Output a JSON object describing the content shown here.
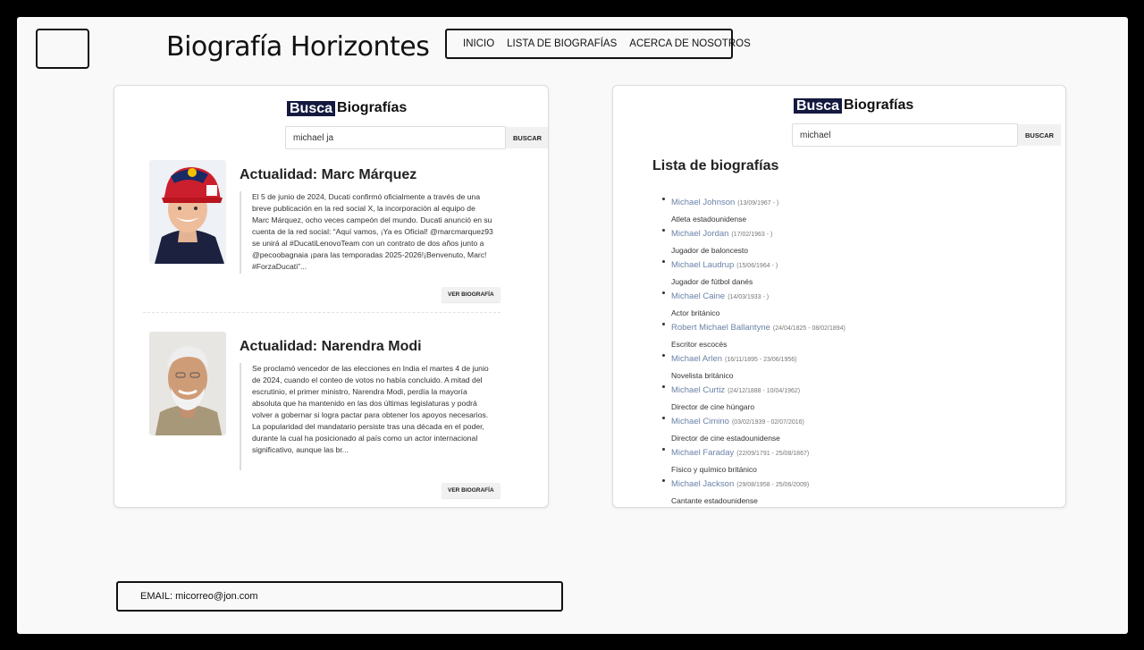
{
  "site": {
    "title": "Biografía Horizontes"
  },
  "nav": {
    "items": [
      "INICIO",
      "LISTA DE BIOGRAFÍAS",
      "ACERCA DE NOSOTROS"
    ]
  },
  "brand": {
    "part1": "Busca",
    "part2": "Biografías"
  },
  "left_panel": {
    "search": {
      "value": "michael ja",
      "button": "BUSCAR"
    },
    "cards": [
      {
        "title": "Actualidad: Marc Márquez",
        "text": "El 5 de junio de 2024, Ducati confirmó oficialmente a través de una breve publicación en la red social X, la incorporación al equipo de Marc Márquez, ocho veces campeón del mundo. Ducati anunció en su cuenta de la red social: “Aquí vamos, ¡Ya es Oficial! @marcmarquez93 se unirá al #DucatiLenovoTeam con un contrato de dos años junto a @pecoobagnaia ¡para las temporadas 2025-2026!¡Benvenuto, Marc! #ForzaDucati”...",
        "button": "VER BIOGRAFÍA"
      },
      {
        "title": "Actualidad: Narendra Modi",
        "text": "Se proclamó vencedor de las elecciones en India el martes 4 de junio de 2024, cuando el conteo de votos no había concluido. A mitad del escrutinio, el primer ministro, Narendra Modi, perdía la mayoría absoluta que ha mantenido en las dos últimas legislaturas y podrá volver a gobernar si logra pactar para obtener los apoyos necesarios. La popularidad del mandatario persiste tras una década en el poder, durante la cual ha posicionado al país como un actor internacional significativo, aunque las br...",
        "button": "VER BIOGRAFÍA"
      }
    ]
  },
  "right_panel": {
    "search": {
      "value": "michael",
      "button": "BUSCAR"
    },
    "list_title": "Lista de biografías",
    "items": [
      {
        "name": "Michael Johnson",
        "dates": "(13/09/1967 - )",
        "desc": "Atleta estadounidense"
      },
      {
        "name": "Michael Jordan",
        "dates": "(17/02/1963 - )",
        "desc": "Jugador de baloncesto"
      },
      {
        "name": "Michael Laudrup",
        "dates": "(15/06/1964 - )",
        "desc": "Jugador de fútbol danés"
      },
      {
        "name": "Michael Caine",
        "dates": "(14/03/1933 - )",
        "desc": "Actor británico"
      },
      {
        "name": "Robert Michael Ballantyne",
        "dates": "(24/04/1825 - 08/02/1894)",
        "desc": "Escritor escocés"
      },
      {
        "name": "Michael Arlen",
        "dates": "(16/11/1895 - 23/06/1956)",
        "desc": "Novelista británico"
      },
      {
        "name": "Michael Curtiz",
        "dates": "(24/12/1888 - 10/04/1962)",
        "desc": "Director de cine húngaro"
      },
      {
        "name": "Michael Cimino",
        "dates": "(03/02/1939 - 02/07/2016)",
        "desc": "Director de cine estadounidense"
      },
      {
        "name": "Michael Faraday",
        "dates": "(22/09/1791 - 25/08/1867)",
        "desc": "Físico y químico británico"
      },
      {
        "name": "Michael Jackson",
        "dates": "(29/08/1958 - 25/06/2009)",
        "desc": "Cantante estadounidense"
      }
    ]
  },
  "footer": {
    "email": "EMAIL: micorreo@jon.com"
  }
}
